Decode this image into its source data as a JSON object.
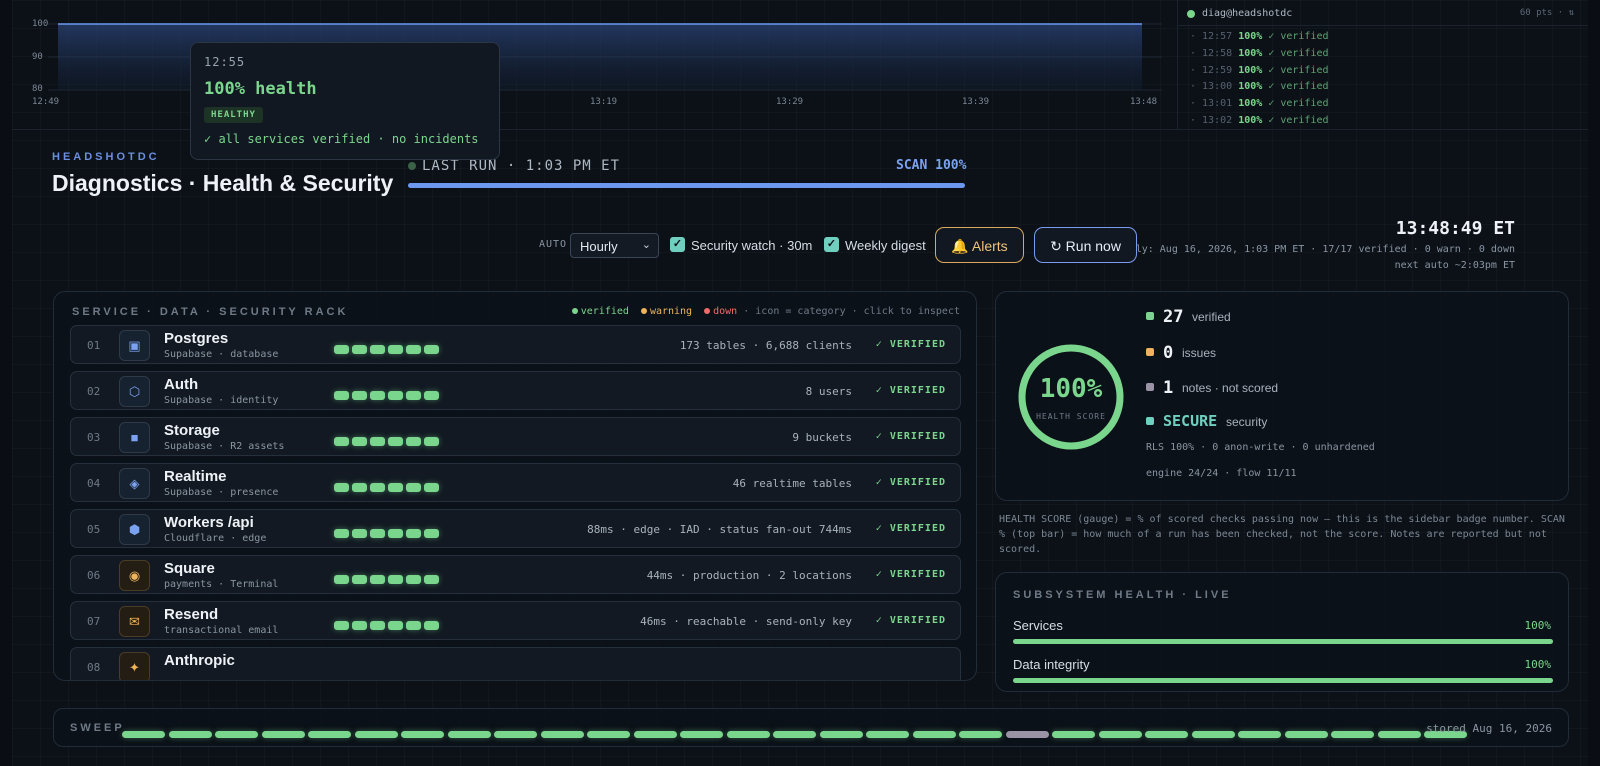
{
  "chart": {
    "y_ticks": [
      "100",
      "90",
      "80"
    ],
    "x_ticks": [
      "12:49",
      "13:19",
      "13:29",
      "13:39",
      "13:48"
    ],
    "ylim": [
      80,
      100
    ],
    "series_values": [
      100,
      100,
      100,
      100,
      100,
      100,
      100,
      100,
      100,
      100,
      100,
      100
    ]
  },
  "tooltip": {
    "time": "12:55",
    "value": "100% health",
    "badge": "HEALTHY",
    "note": "✓ all services verified · no incidents"
  },
  "log": {
    "user": "diag@headshotdc",
    "pts": "60 pts · ⇅",
    "lines": [
      {
        "time": "· 12:57",
        "pct": "100%",
        "status": "✓ verified"
      },
      {
        "time": "· 12:58",
        "pct": "100%",
        "status": "✓ verified"
      },
      {
        "time": "· 12:59",
        "pct": "100%",
        "status": "✓ verified"
      },
      {
        "time": "· 13:00",
        "pct": "100%",
        "status": "✓ verified"
      },
      {
        "time": "· 13:01",
        "pct": "100%",
        "status": "✓ verified"
      },
      {
        "time": "· 13:02",
        "pct": "100%",
        "status": "✓ verified"
      }
    ]
  },
  "header": {
    "brand": "HEADSHOTDC",
    "title": "Diagnostics · Health & Security",
    "last_run": "LAST RUN · 1:03 PM ET",
    "scan_label": "SCAN 100%",
    "scan_progress": 1.0,
    "clock": "13:48:49 ET",
    "nightly": "last nightly: Aug 16, 2026, 1:03 PM ET · 17/17 verified · 0 warn · 0 down",
    "next_auto": "next auto ~2:03pm ET"
  },
  "controls": {
    "auto_label": "AUTO",
    "schedule_value": "Hourly",
    "security_watch": "Security watch · 30m",
    "weekly_digest": "Weekly digest",
    "alerts_button": "🔔 Alerts",
    "run_button": "↻ Run now"
  },
  "rack": {
    "title": "SERVICE · DATA · SECURITY RACK",
    "legend": {
      "verified": "verified",
      "warning": "warning",
      "down": "down",
      "hint": "· icon = category · click to inspect"
    },
    "rows": [
      {
        "num": "01",
        "icon": "database-icon",
        "glyph": "▣",
        "warm": false,
        "name": "Postgres",
        "sub": "Supabase · database",
        "detail": "173 tables · 6,688 clients",
        "status": "✓ VERIFIED"
      },
      {
        "num": "02",
        "icon": "identity-icon",
        "glyph": "⬡",
        "warm": false,
        "name": "Auth",
        "sub": "Supabase · identity",
        "detail": "8 users",
        "status": "✓ VERIFIED"
      },
      {
        "num": "03",
        "icon": "storage-icon",
        "glyph": "■",
        "warm": false,
        "name": "Storage",
        "sub": "Supabase · R2 assets",
        "detail": "9 buckets",
        "status": "✓ VERIFIED"
      },
      {
        "num": "04",
        "icon": "realtime-icon",
        "glyph": "◈",
        "warm": false,
        "name": "Realtime",
        "sub": "Supabase · presence",
        "detail": "46 realtime tables",
        "status": "✓ VERIFIED"
      },
      {
        "num": "05",
        "icon": "edge-icon",
        "glyph": "⬢",
        "warm": false,
        "name": "Workers /api",
        "sub": "Cloudflare · edge",
        "detail": "88ms · edge · IAD · status fan-out 744ms",
        "status": "✓ VERIFIED"
      },
      {
        "num": "06",
        "icon": "payments-icon",
        "glyph": "◉",
        "warm": true,
        "name": "Square",
        "sub": "payments · Terminal",
        "detail": "44ms · production · 2 locations",
        "status": "✓ VERIFIED"
      },
      {
        "num": "07",
        "icon": "email-icon",
        "glyph": "✉",
        "warm": true,
        "name": "Resend",
        "sub": "transactional email",
        "detail": "46ms · reachable · send-only key",
        "status": "✓ VERIFIED"
      },
      {
        "num": "08",
        "icon": "ai-icon",
        "glyph": "✦",
        "warm": true,
        "name": "Anthropic",
        "sub": "",
        "detail": "",
        "status": ""
      }
    ]
  },
  "health": {
    "score": "100%",
    "score_fraction": 1.0,
    "score_label": "HEALTH SCORE",
    "verified_count": "27",
    "verified_label": "verified",
    "issues_count": "0",
    "issues_label": "issues",
    "notes_count": "1",
    "notes_label": "notes · not scored",
    "security_value": "SECURE",
    "security_label": "security",
    "rls_line": "RLS 100% · 0 anon-write · 0 unhardened",
    "engine_line": "engine 24/24 · flow 11/11"
  },
  "note": "HEALTH SCORE (gauge) = % of scored checks passing now — this is the sidebar badge number. SCAN % (top bar) = how much of a run has been checked, not the score.  Notes are reported but not scored.",
  "subsystems": {
    "title": "SUBSYSTEM HEALTH · LIVE",
    "items": [
      {
        "label": "Services",
        "pct": "100%",
        "fraction": 1.0
      },
      {
        "label": "Data integrity",
        "pct": "100%",
        "fraction": 1.0
      }
    ]
  },
  "sweep": {
    "label": "SWEEP",
    "stored": "stored Aug 16, 2026",
    "segments": [
      "ok",
      "ok",
      "ok",
      "ok",
      "ok",
      "ok",
      "ok",
      "ok",
      "ok",
      "ok",
      "ok",
      "ok",
      "ok",
      "ok",
      "ok",
      "ok",
      "ok",
      "ok",
      "ok",
      "note",
      "ok",
      "ok",
      "ok",
      "ok",
      "ok",
      "ok",
      "ok",
      "ok",
      "ok"
    ]
  },
  "colors": {
    "verified": "#7bd68d",
    "warning": "#f0b35a",
    "down": "#f06b6b",
    "notes": "#9a93a6",
    "security": "#6fd0c0",
    "accent": "#6c98f0"
  }
}
